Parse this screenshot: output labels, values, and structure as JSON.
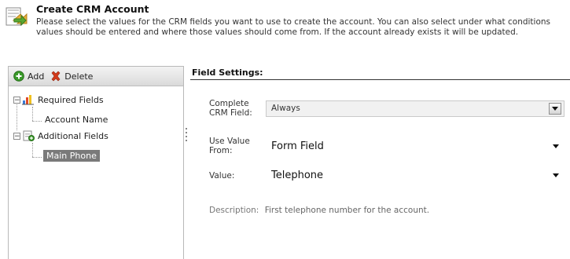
{
  "header": {
    "title": "Create CRM Account",
    "description_line1": "Please select the values for the CRM fields you want to use to create the account. You can also select under what conditions",
    "description_line2": "values should be entered and where those values should come from. If the account already exists it will be updated."
  },
  "toolbar": {
    "add_label": "Add",
    "delete_label": "Delete"
  },
  "tree": {
    "required_label": "Required Fields",
    "required_children": [
      "Account Name"
    ],
    "additional_label": "Additional Fields",
    "additional_children": [
      "Main Phone"
    ],
    "selected": "Main Phone",
    "expanded_symbol": "−"
  },
  "settings": {
    "title": "Field Settings:",
    "complete_label": "Complete CRM Field:",
    "complete_value": "Always",
    "use_value_label": "Use Value From:",
    "use_value_value": "Form Field",
    "value_label": "Value:",
    "value_value": "Telephone",
    "description_label": "Description:",
    "description_value": "First telephone number for the account."
  },
  "colors": {
    "add_icon": "#3a9a2a",
    "delete_icon": "#d33a1a",
    "selected_bg": "#7a7a7a"
  }
}
